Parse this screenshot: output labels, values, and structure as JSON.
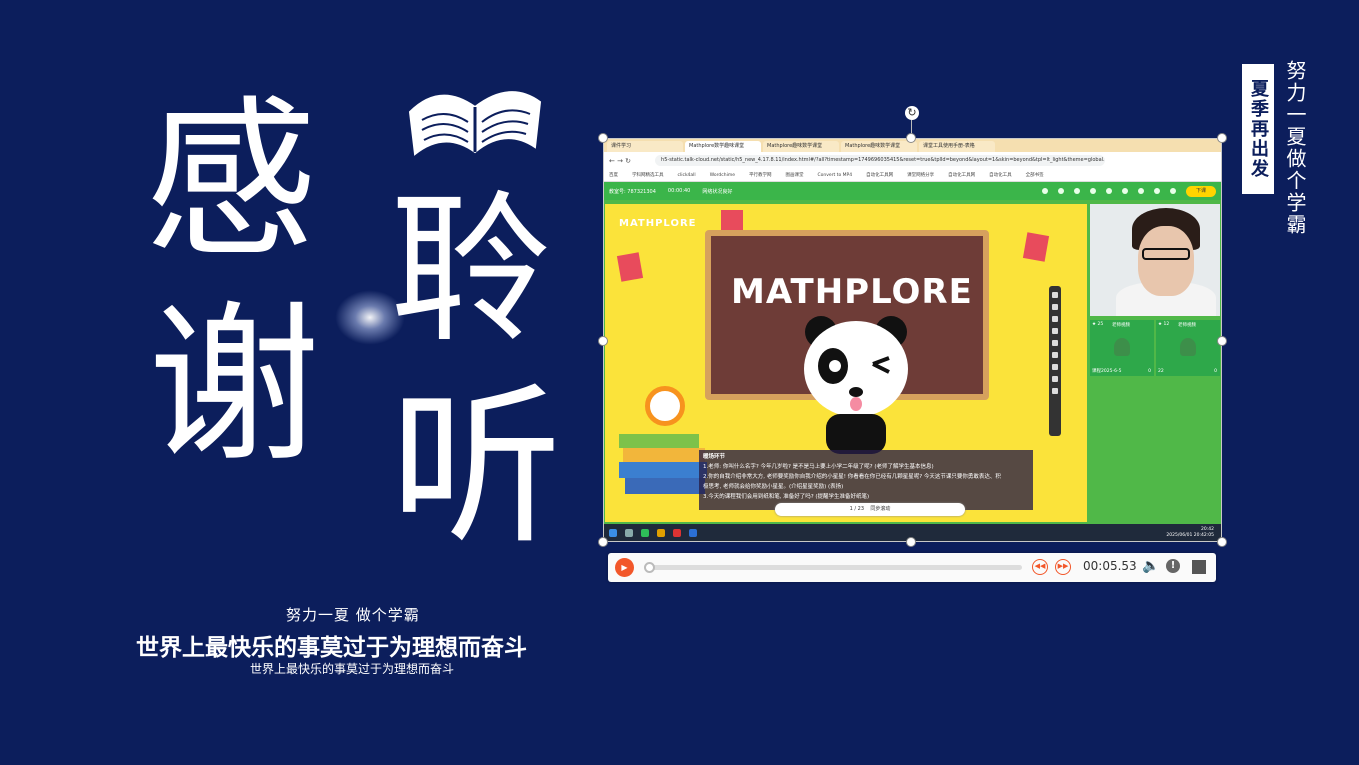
{
  "hero": {
    "char1": "感",
    "char2": "聆",
    "char3": "谢",
    "char4": "听"
  },
  "slogans": {
    "small": "努力一夏 做个学霸",
    "main": "世界上最快乐的事莫过于为理想而奋斗",
    "sub": "世界上最快乐的事莫过于为理想而奋斗"
  },
  "side": {
    "badge": "夏季再出发",
    "vertical": "努力一夏做个学霸"
  },
  "browser": {
    "tabs": [
      "课件学习",
      "Mathplore数学趣味课堂",
      "Mathplore趣味数学课堂",
      "Mathplore趣味数学课堂",
      "课堂工具使用手册-表格"
    ],
    "url": "h5-static.talk-cloud.net/static/h5_new_4.17.8.11/index.html#/?all?timestamp=1749696035415&reset=true&tplId=beyond&layout=1&skin=beyond&tpl=lt_light&theme=global.talk-cloud.net",
    "bookmarks": [
      "百度",
      "学科网精选工具",
      "click4all",
      "Wordchime",
      "平行教学网",
      "图画课堂",
      "Convert to MP4",
      "自动化工具网",
      "课堂网络分享",
      "自动化工具网",
      "自动化工具",
      "全部书签"
    ]
  },
  "classroom": {
    "room": "教室号: 787321304",
    "timer": "00:00:40",
    "network": "网络状况良好",
    "exit": "下课",
    "logo_small": "MATHPLORE",
    "logo_big": "MATHPLORE",
    "notes": [
      "暖场环节",
      "1.老师: 你叫什么名字? 今年几岁啦? 是不是马上要上小学二年级了呢? (老师了解学生基本信息)",
      "2.你的自我介绍非常大方, 老师要奖励你自我介绍的小星星! 你看看在你已经有几颗星星呢? 今天这节课只要你勇敢表达、积",
      "极思考, 老师就会给你奖励小星星。(介绍星星奖励) (表扬)",
      "3.今天的课程我们会用到纸和笔, 准备好了吗? (提醒学生准备好纸笔)"
    ],
    "page": "1 / 23",
    "sync": "同步滚动",
    "students": [
      {
        "stars": "★ 25",
        "label": "老师视频",
        "name": "课程2025-6-5",
        "count": "0"
      },
      {
        "stars": "★ 12",
        "label": "老师视频",
        "name": "22",
        "count": "0"
      }
    ]
  },
  "taskbar": {
    "time": "20:42",
    "date": "2025/06/01 20:42:05"
  },
  "player": {
    "time": "00:05.53"
  },
  "colors": {
    "background": "#0c1e5c",
    "accent": "#f2572a",
    "classroom_green": "#3bb54a"
  }
}
